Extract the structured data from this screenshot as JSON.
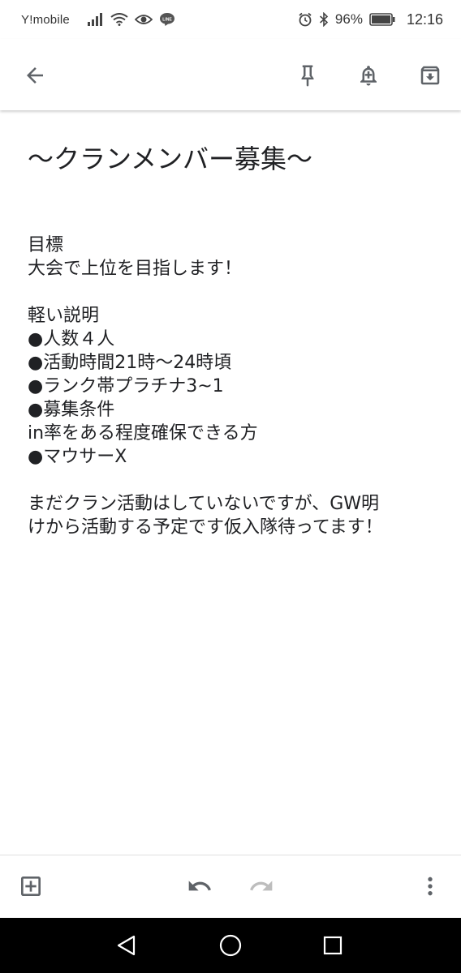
{
  "status_bar": {
    "carrier": "Y!mobile",
    "battery_percent": "96%",
    "time": "12:16",
    "icons": [
      "signal-icon",
      "wifi-icon",
      "eye-icon",
      "line-app-icon",
      "alarm-icon",
      "bluetooth-icon",
      "battery-icon"
    ]
  },
  "toolbar": {
    "icons": [
      "back-arrow-icon",
      "pin-icon",
      "add-reminder-icon",
      "archive-icon"
    ]
  },
  "note": {
    "title": "～クランメンバー募集～",
    "lines": [
      "目標",
      "大会で上位を目指します！",
      "",
      "軽い説明",
      "●人数４人",
      "●活動時間21時～24時頃",
      "●ランク帯プラチナ3~1",
      "●募集条件",
      "in率をある程度確保できる方",
      "●マウサーX",
      "",
      "まだクラン活動はしていないですが、GW明",
      "けから活動する予定です仮入隊待ってます！"
    ]
  },
  "bottom_bar": {
    "icons": [
      "add-box-icon",
      "undo-icon",
      "redo-icon",
      "more-vert-icon"
    ]
  },
  "nav_bar": {
    "icons": [
      "nav-back-icon",
      "nav-home-icon",
      "nav-recents-icon"
    ]
  },
  "colors": {
    "icon_dark": "#5f6368",
    "icon_disabled": "#bdbdbd",
    "text": "#202124",
    "nav_background": "#000000"
  }
}
